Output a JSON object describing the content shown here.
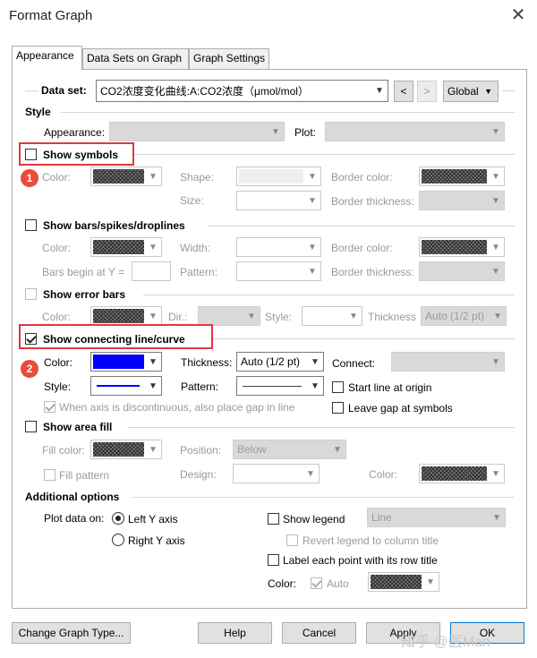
{
  "window": {
    "title": "Format Graph",
    "close_glyph": "✕"
  },
  "tabs": [
    "Appearance",
    "Data Sets on Graph",
    "Graph Settings"
  ],
  "dataset": {
    "label": "Data set:",
    "value": "CO2浓度变化曲线:A:CO2浓度（μmol/mol）",
    "prev": "<",
    "next": ">",
    "scope": "Global"
  },
  "style": {
    "heading": "Style",
    "appearance_label": "Appearance:",
    "plot_label": "Plot:"
  },
  "symbols": {
    "heading": "Show symbols",
    "color": "Color:",
    "shape": "Shape:",
    "border_color": "Border color:",
    "size": "Size:",
    "border_thickness": "Border thickness:"
  },
  "bars": {
    "heading": "Show bars/spikes/droplines",
    "color": "Color:",
    "width": "Width:",
    "border_color": "Border color:",
    "bars_begin": "Bars begin at Y =",
    "pattern": "Pattern:",
    "border_thickness": "Border thickness:"
  },
  "errorbars": {
    "heading": "Show error bars",
    "color": "Color:",
    "dir": "Dir.:",
    "style": "Style:",
    "thickness": "Thickness",
    "thickness_value": "Auto (1/2 pt)"
  },
  "connecting": {
    "heading": "Show connecting line/curve",
    "color": "Color:",
    "thickness": "Thickness:",
    "thickness_value": "Auto (1/2 pt)",
    "connect": "Connect:",
    "style": "Style:",
    "pattern": "Pattern:",
    "start_line": "Start line at origin",
    "gap_text": "When axis is discontinuous, also place gap in line",
    "leave_gap": "Leave gap at symbols",
    "line_color": "#0000ff"
  },
  "area": {
    "heading": "Show area fill",
    "fill_color": "Fill color:",
    "position": "Position:",
    "position_value": "Below",
    "fill_pattern": "Fill pattern",
    "design": "Design:",
    "color": "Color:"
  },
  "additional": {
    "heading": "Additional options",
    "plot_data_on": "Plot data on:",
    "left_y": "Left Y axis",
    "right_y": "Right  Y axis",
    "show_legend": "Show legend",
    "legend_value": "Line",
    "revert_legend": "Revert legend to column title",
    "label_each": "Label each point with its row title",
    "color": "Color:",
    "auto": "Auto"
  },
  "buttons": {
    "change": "Change Graph Type...",
    "help": "Help",
    "cancel": "Cancel",
    "apply": "Apply",
    "ok": "OK"
  },
  "badges": [
    "1",
    "2"
  ],
  "watermark": "知乎 @医Man",
  "colors": {
    "highlight": "#e0393e",
    "badge": "#e84c3d",
    "line_blue": "#0000ff"
  }
}
